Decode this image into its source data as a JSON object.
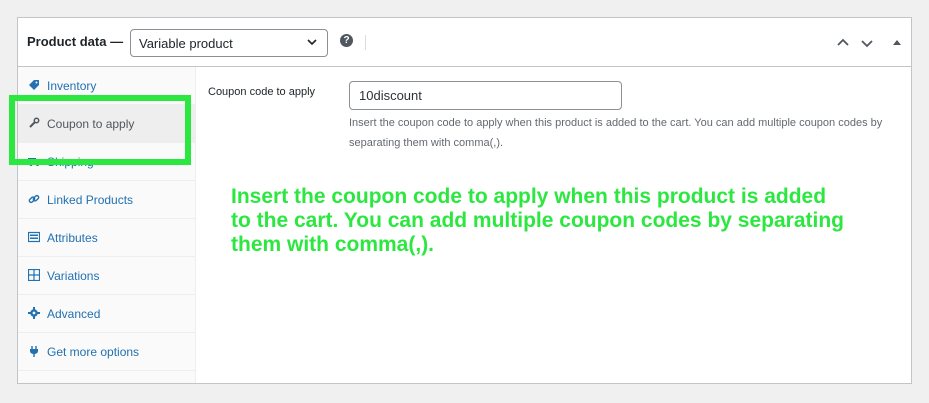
{
  "header": {
    "title": "Product data —",
    "product_type": "Variable product",
    "help_icon": "?"
  },
  "sidebar": {
    "items": [
      {
        "label": "Inventory",
        "icon": "tag-icon"
      },
      {
        "label": "Coupon to apply",
        "icon": "wrench-icon",
        "active": true
      },
      {
        "label": "Shipping",
        "icon": "truck-icon"
      },
      {
        "label": "Linked Products",
        "icon": "link-icon"
      },
      {
        "label": "Attributes",
        "icon": "list-icon"
      },
      {
        "label": "Variations",
        "icon": "grid-icon"
      },
      {
        "label": "Advanced",
        "icon": "gear-icon"
      },
      {
        "label": "Get more options",
        "icon": "plugin-icon"
      }
    ]
  },
  "coupon": {
    "label": "Coupon code to apply",
    "value": "10discount",
    "description": "Insert the coupon code to apply when this product is added to the cart. You can add multiple coupon codes by separating them with comma(,)."
  },
  "annotation": {
    "text": "Insert the coupon code to apply when this product is added to the cart. You can add multiple coupon codes by separating them with comma(,).",
    "color": "#2ce73f"
  },
  "colors": {
    "link": "#2271b1",
    "highlight": "#2ce73f"
  }
}
